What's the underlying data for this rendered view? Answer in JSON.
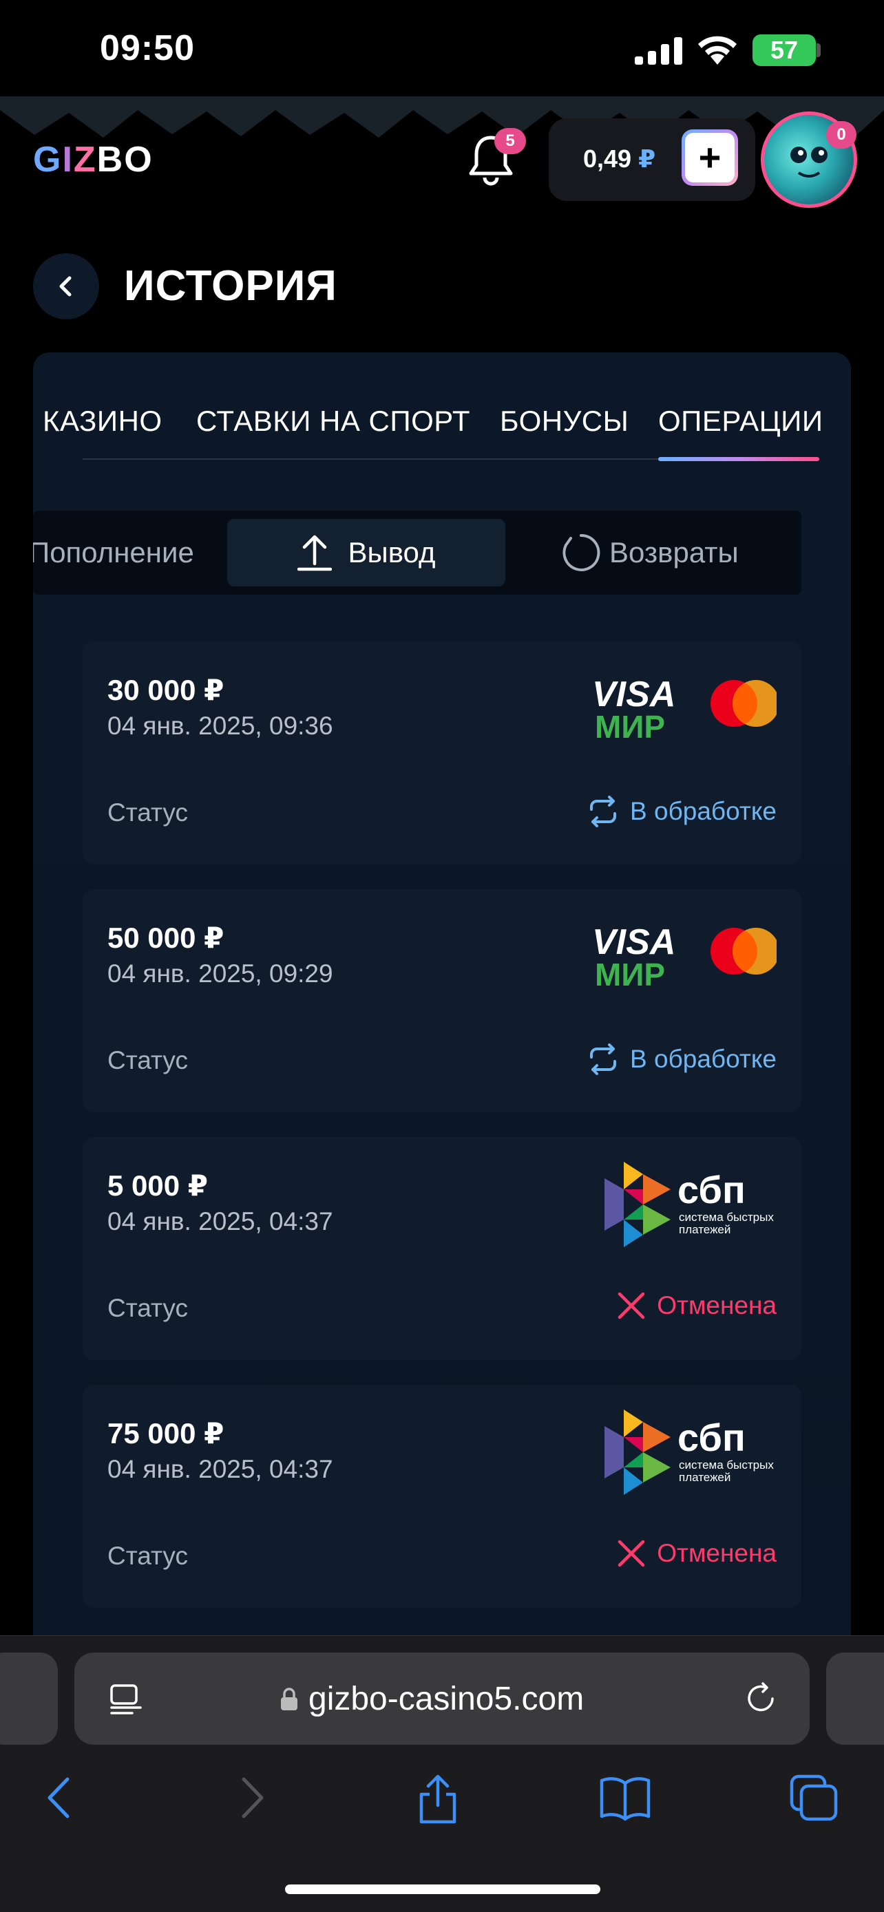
{
  "status_bar": {
    "time": "09:50",
    "battery": "57"
  },
  "header": {
    "logo": {
      "g": "G",
      "i": "I",
      "z": "Z",
      "bo": "BO"
    },
    "notifications_count": "5",
    "balance": {
      "amount": "0,49",
      "currency": "₽"
    },
    "deposit_label": "+",
    "avatar_badge": "0"
  },
  "page": {
    "title": "ИСТОРИЯ"
  },
  "tabs": [
    {
      "label": "КАЗИНО"
    },
    {
      "label": "СТАВКИ НА СПОРТ"
    },
    {
      "label": "БОНУСЫ"
    },
    {
      "label": "ОПЕРАЦИИ",
      "active": true
    }
  ],
  "segments": {
    "deposit": "Пополнение",
    "withdraw": "Вывод",
    "refunds": "Возвраты",
    "active": "withdraw"
  },
  "transactions": [
    {
      "amount": "30 000 ₽",
      "date": "04 янв. 2025, 09:36",
      "status_label": "Статус",
      "status": "В обработке",
      "method": "card"
    },
    {
      "amount": "50 000 ₽",
      "date": "04 янв. 2025, 09:29",
      "status_label": "Статус",
      "status": "В обработке",
      "method": "card"
    },
    {
      "amount": "5 000 ₽",
      "date": "04 янв. 2025, 04:37",
      "status_label": "Статус",
      "status": "Отменена",
      "method": "sbp"
    },
    {
      "amount": "75 000 ₽",
      "date": "04 янв. 2025, 04:37",
      "status_label": "Статус",
      "status": "Отменена",
      "method": "sbp"
    }
  ],
  "payment_logos": {
    "visa": "VISA",
    "mir": "МИР",
    "sbp": "сбп",
    "sbp_line1": "система быстрых",
    "sbp_line2": "платежей"
  },
  "browser": {
    "url": "gizbo-casino5.com"
  },
  "colors": {
    "processing": "#6fb6f2",
    "cancelled": "#ff3b6b",
    "accent_gradient": [
      "#6ab0ff",
      "#c08cf0",
      "#ff4d8d"
    ]
  }
}
